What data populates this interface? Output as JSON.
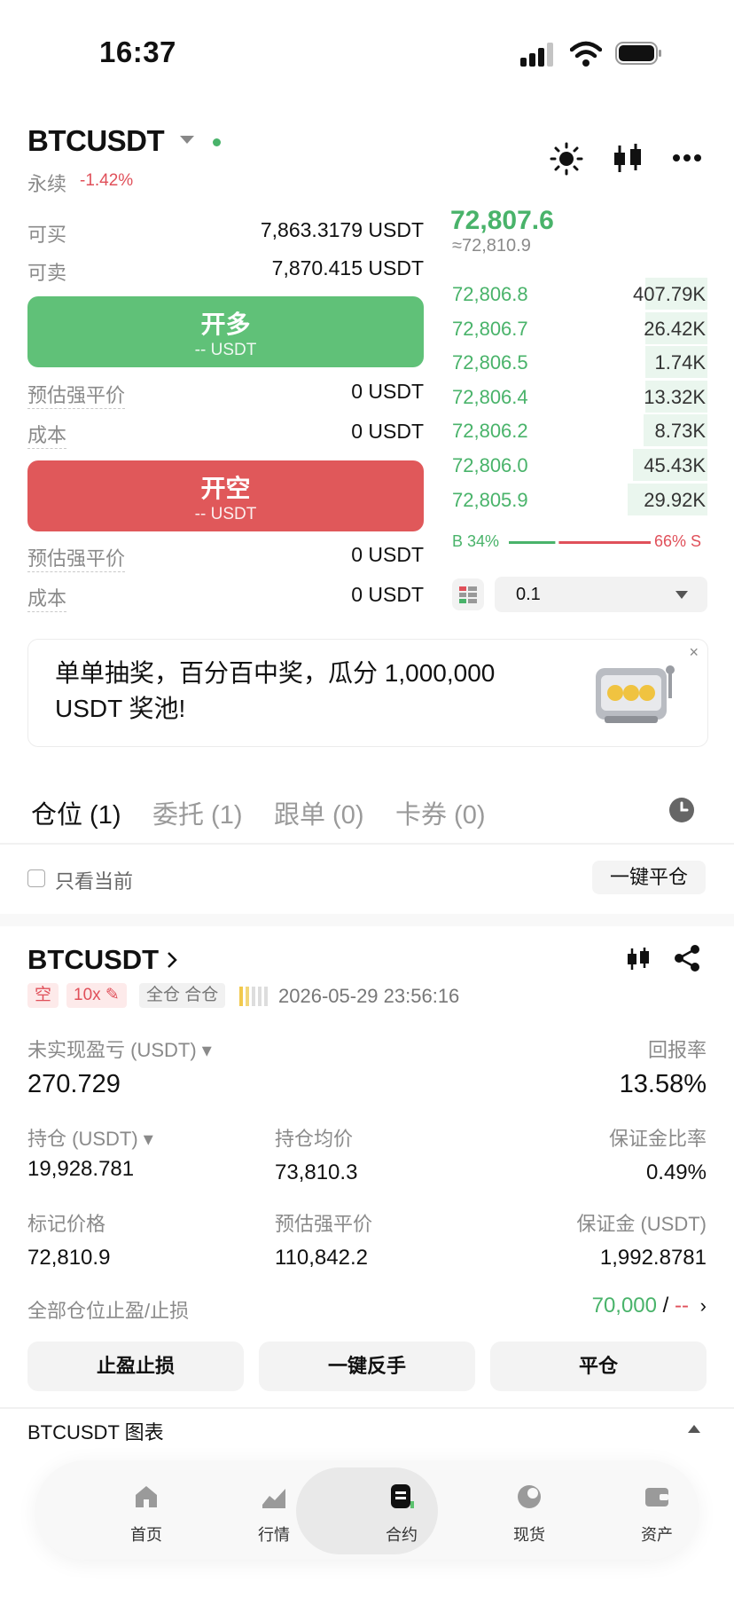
{
  "status_bar": {
    "time": "16:37"
  },
  "header": {
    "symbol": "BTCUSDT",
    "contract_type": "永续",
    "change": "-1.42%"
  },
  "trade_panel": {
    "buy_available_label": "可买",
    "buy_available_value": "7,863.3179 USDT",
    "sell_available_label": "可卖",
    "sell_available_value": "7,870.415 USDT",
    "long_button": {
      "label": "开多",
      "sub": "-- USDT"
    },
    "short_button": {
      "label": "开空",
      "sub": "-- USDT"
    },
    "long_liq_label": "预估强平价",
    "long_liq_value": "0 USDT",
    "long_cost_label": "成本",
    "long_cost_value": "0 USDT",
    "short_liq_label": "预估强平价",
    "short_liq_value": "0 USDT",
    "short_cost_label": "成本",
    "short_cost_value": "0 USDT"
  },
  "order_book": {
    "last_price": "72,807.6",
    "mark_approx": "≈72,810.9",
    "bids": [
      {
        "price": "72,806.8",
        "qty": "407.79K",
        "depth": 0.24
      },
      {
        "price": "72,806.7",
        "qty": "26.42K",
        "depth": 0.24
      },
      {
        "price": "72,806.5",
        "qty": "1.74K",
        "depth": 0.24
      },
      {
        "price": "72,806.4",
        "qty": "13.32K",
        "depth": 0.24
      },
      {
        "price": "72,806.2",
        "qty": "8.73K",
        "depth": 0.25
      },
      {
        "price": "72,806.0",
        "qty": "45.43K",
        "depth": 0.29
      },
      {
        "price": "72,805.9",
        "qty": "29.92K",
        "depth": 0.31
      }
    ],
    "buy_ratio_label": "B 34%",
    "sell_ratio_label": "66% S",
    "buy_ratio": 0.34,
    "precision": "0.1"
  },
  "banner": {
    "text": "单单抽奖，百分百中奖，瓜分 1,000,000 USDT 奖池!",
    "close": "×"
  },
  "tabs": [
    {
      "label": "仓位 (1)"
    },
    {
      "label": "委托 (1)"
    },
    {
      "label": "跟单 (0)"
    },
    {
      "label": "卡券 (0)"
    }
  ],
  "filter": {
    "only_current": "只看当前",
    "close_all": "一键平仓"
  },
  "position": {
    "symbol": "BTCUSDT",
    "side": "空",
    "leverage": "10x",
    "margin_mode": "全仓 合仓",
    "time": "2026-05-29 23:56:16",
    "unrealized_label": "未实现盈亏 (USDT)",
    "unrealized_value": "270.729",
    "roe_label": "回报率",
    "roe_value": "13.58%",
    "size_label": "持仓 (USDT)",
    "size_value": "19,928.781",
    "entry_label": "持仓均价",
    "entry_value": "73,810.3",
    "margin_ratio_label": "保证金比率",
    "margin_ratio_value": "0.49%",
    "mark_label": "标记价格",
    "mark_value": "72,810.9",
    "liq_label": "预估强平价",
    "liq_value": "110,842.2",
    "margin_label": "保证金 (USDT)",
    "margin_value": "1,992.8781",
    "tpsl_label": "全部仓位止盈/止损",
    "tp_value": "70,000",
    "tpsl_sep": " / ",
    "sl_value": "--",
    "actions": [
      {
        "label": "止盈止损"
      },
      {
        "label": "一键反手"
      },
      {
        "label": "平仓"
      }
    ]
  },
  "chart_section": {
    "title": "BTCUSDT 图表"
  },
  "nav": [
    {
      "label": "首页",
      "icon": "home-icon"
    },
    {
      "label": "行情",
      "icon": "market-icon"
    },
    {
      "label": "合约",
      "icon": "futures-icon"
    },
    {
      "label": "现货",
      "icon": "spot-icon"
    },
    {
      "label": "资产",
      "icon": "wallet-icon"
    }
  ],
  "colors": {
    "green": "#49b36a",
    "red": "#e0505a"
  }
}
